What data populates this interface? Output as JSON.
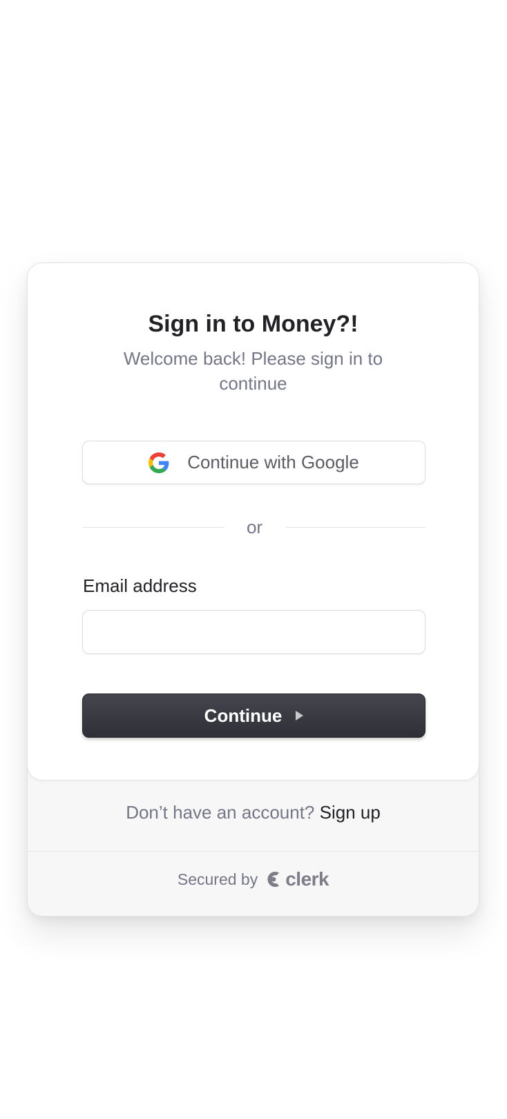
{
  "signin": {
    "title": "Sign in to Money?!",
    "subtitle": "Welcome back! Please sign in to continue",
    "google_button_label": "Continue with Google",
    "divider_text": "or",
    "email_label": "Email address",
    "email_value": "",
    "email_placeholder": "",
    "continue_label": "Continue"
  },
  "footer": {
    "signup_prompt": "Don’t have an account?",
    "signup_link": "Sign up",
    "secured_by": "Secured by",
    "brand_name": "clerk"
  },
  "icons": {
    "google": "google-g-icon",
    "continue_arrow": "triangle-right-icon",
    "clerk_mark": "clerk-logo-icon"
  },
  "colors": {
    "primary_button": "#2f3037",
    "text_primary": "#212126",
    "text_muted": "#747686",
    "footer_bg": "#f7f7f7"
  }
}
